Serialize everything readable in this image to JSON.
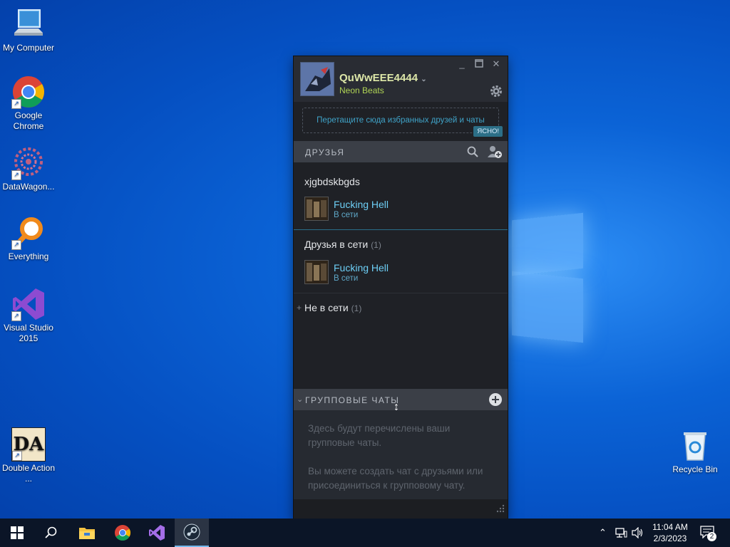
{
  "desktop": {
    "icons": [
      {
        "label": "My Computer"
      },
      {
        "label": "Google Chrome"
      },
      {
        "label": "DataWagon..."
      },
      {
        "label": "Everything"
      },
      {
        "label": "Visual Studio 2015"
      },
      {
        "label": "Double Action ..."
      },
      {
        "label": "Recycle Bin"
      }
    ]
  },
  "steam": {
    "username": "QuWwEEE4444",
    "status": "Neon Beats",
    "dropzone": "Перетащите сюда избранных друзей и чаты",
    "dismiss_label": "ЯСНО!",
    "friends_header": "ДРУЗЬЯ",
    "groups": [
      {
        "title": "xjgbdskbgds",
        "count": ""
      },
      {
        "title": "Друзья в сети",
        "count": "(1)"
      },
      {
        "title": "Не в сети",
        "count": "(1)"
      }
    ],
    "friends": [
      {
        "name": "Fucking Hell",
        "status": "В сети"
      },
      {
        "name": "Fucking Hell",
        "status": "В сети"
      }
    ],
    "group_chats_header": "ГРУППОВЫЕ ЧАТЫ",
    "gc_text1": "Здесь будут перечислены ваши групповые чаты.",
    "gc_text2": "Вы можете создать чат с друзьями или присоединиться к групповому чату."
  },
  "taskbar": {
    "time": "11:04 AM",
    "date": "2/3/2023",
    "notifications": "2"
  },
  "colors": {
    "accent": "#6dcff6",
    "username": "#dde7a8",
    "status": "#b0d455"
  }
}
